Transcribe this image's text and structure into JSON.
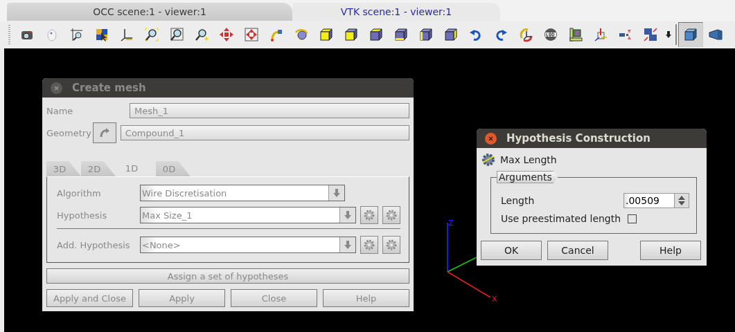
{
  "viewer_tabs": [
    {
      "label": "OCC scene:1 - viewer:1",
      "selected": false
    },
    {
      "label": "VTK scene:1 - viewer:1",
      "selected": true
    }
  ],
  "toolbar": {
    "view_modes": [
      {
        "selected": true
      },
      {
        "selected": false
      }
    ]
  },
  "axes": {
    "z_label": "Z",
    "x_label": "X"
  },
  "create_mesh": {
    "title": "Create mesh",
    "active": false,
    "name": {
      "label": "Name",
      "value": "Mesh_1"
    },
    "geometry": {
      "label": "Geometry",
      "value": "Compound_1"
    },
    "tabs": [
      {
        "label": "3D",
        "selected": false
      },
      {
        "label": "2D",
        "selected": false
      },
      {
        "label": "1D",
        "selected": true
      },
      {
        "label": "0D",
        "selected": false
      }
    ],
    "algorithm": {
      "label": "Algorithm",
      "value": "Wire Discretisation"
    },
    "hypothesis": {
      "label": "Hypothesis",
      "value": "Max Size_1"
    },
    "add_hypothesis": {
      "label": "Add. Hypothesis",
      "value": "<None>"
    },
    "assign_button": "Assign a set of hypotheses",
    "buttons": [
      "Apply and Close",
      "Apply",
      "Close",
      "Help"
    ]
  },
  "hypothesis_dialog": {
    "title": "Hypothesis Construction",
    "active": true,
    "hypothesis_type": "Max Length",
    "group": "Arguments",
    "length": {
      "label": "Length",
      "value": ".00509"
    },
    "preestimated": {
      "label": "Use preestimated length",
      "checked": false
    },
    "buttons": [
      "OK",
      "Cancel",
      "Help"
    ]
  }
}
